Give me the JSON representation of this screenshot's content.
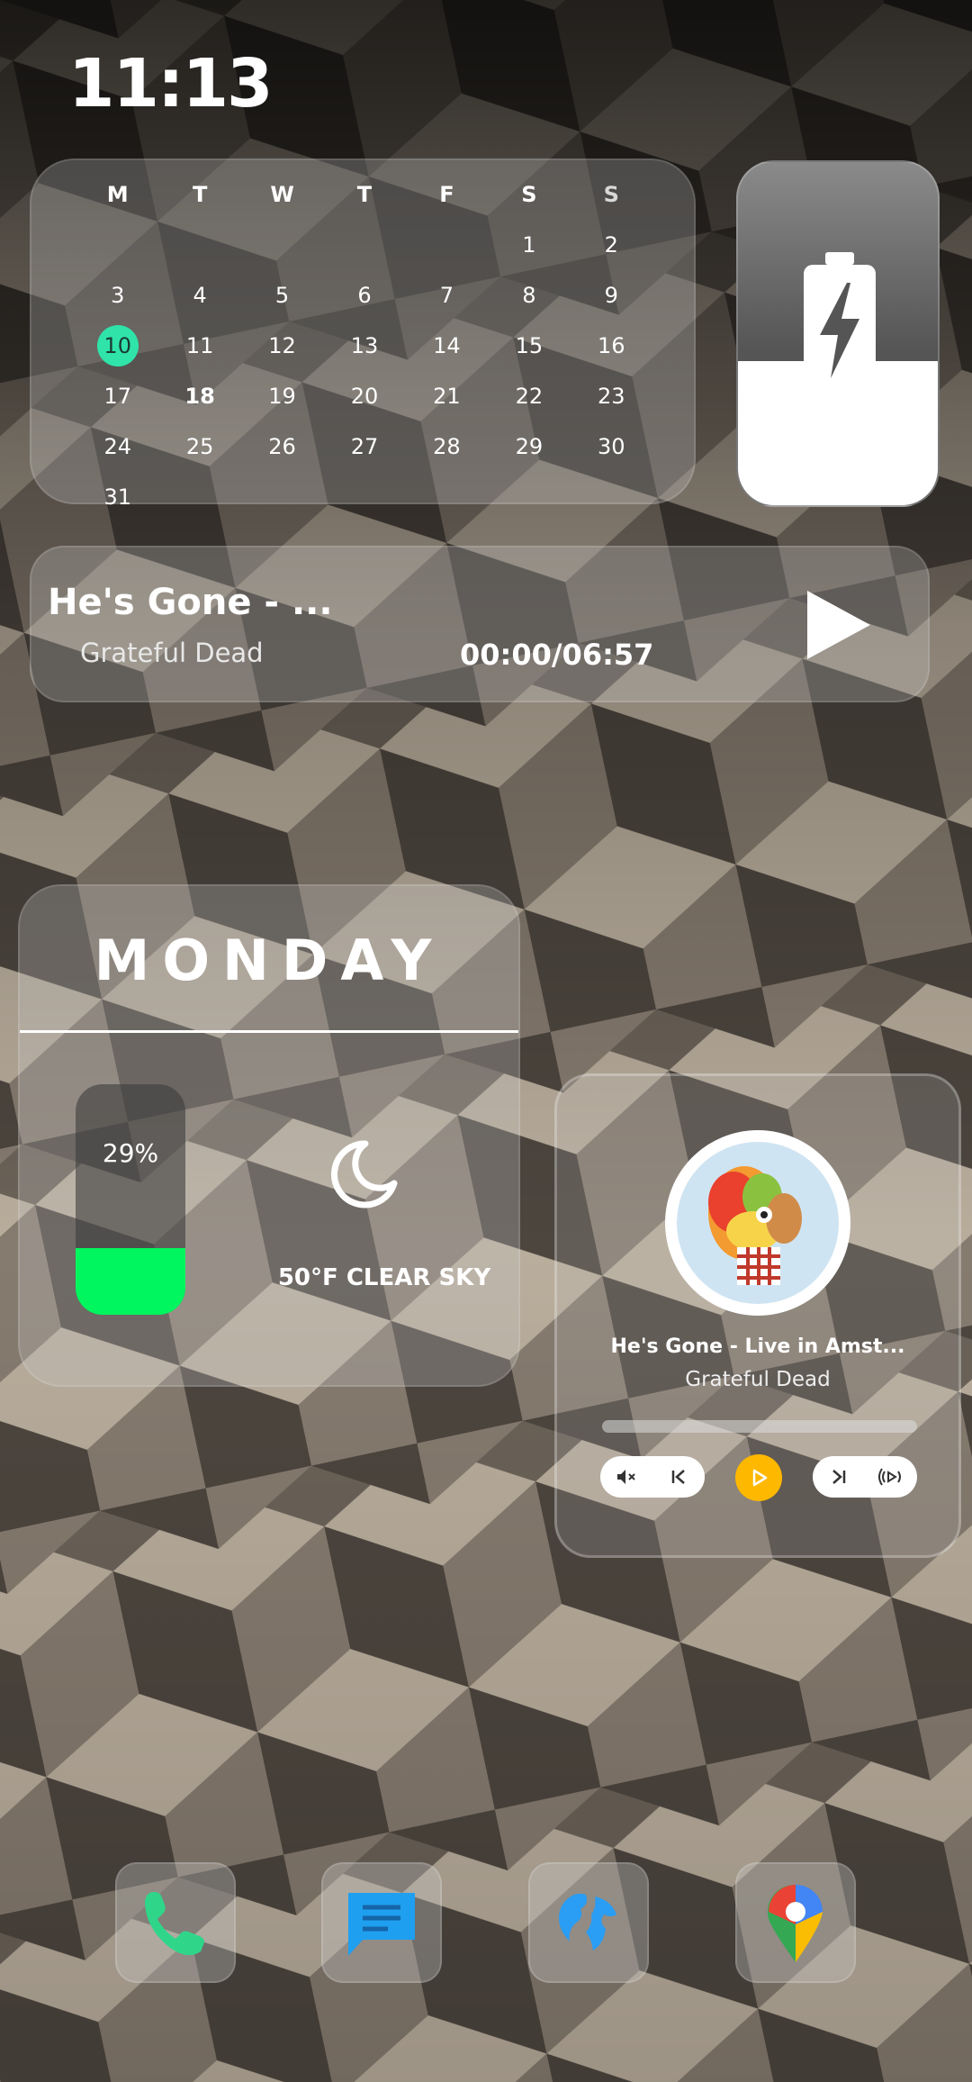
{
  "clock": {
    "time": "11:13"
  },
  "calendar": {
    "weekdays": [
      "M",
      "T",
      "W",
      "T",
      "F",
      "S",
      "S"
    ],
    "leading_blanks": 5,
    "days": [
      "1",
      "2",
      "3",
      "4",
      "5",
      "6",
      "7",
      "8",
      "9",
      "10",
      "11",
      "12",
      "13",
      "14",
      "15",
      "16",
      "17",
      "18",
      "19",
      "20",
      "21",
      "22",
      "23",
      "24",
      "25",
      "26",
      "27",
      "28",
      "29",
      "30",
      "31"
    ],
    "today": "10",
    "bold_day": "18"
  },
  "battery_widget": {
    "level": 0.42,
    "icon": "battery-charging-icon"
  },
  "media_bar": {
    "title": "He's Gone - ...",
    "artist": "Grateful Dead",
    "time": "00:00/06:57",
    "play_icon": "play-icon"
  },
  "day_widget": {
    "day": "MONDAY",
    "battery_percent_label": "29%",
    "battery_level": 0.29,
    "weather_icon": "moon-icon",
    "weather_text": "50°F CLEAR SKY",
    "battery_color": "#00f65e"
  },
  "player": {
    "title": "He's Gone - Live in Amst...",
    "artist": "Grateful Dead",
    "progress": 0.0,
    "accent": "#ffb800",
    "controls": [
      "mute-icon",
      "previous-icon",
      "play-icon",
      "next-icon",
      "broadcast-icon"
    ]
  },
  "dock": {
    "apps": [
      "phone-icon",
      "messages-icon",
      "globe-icon",
      "maps-icon"
    ]
  }
}
